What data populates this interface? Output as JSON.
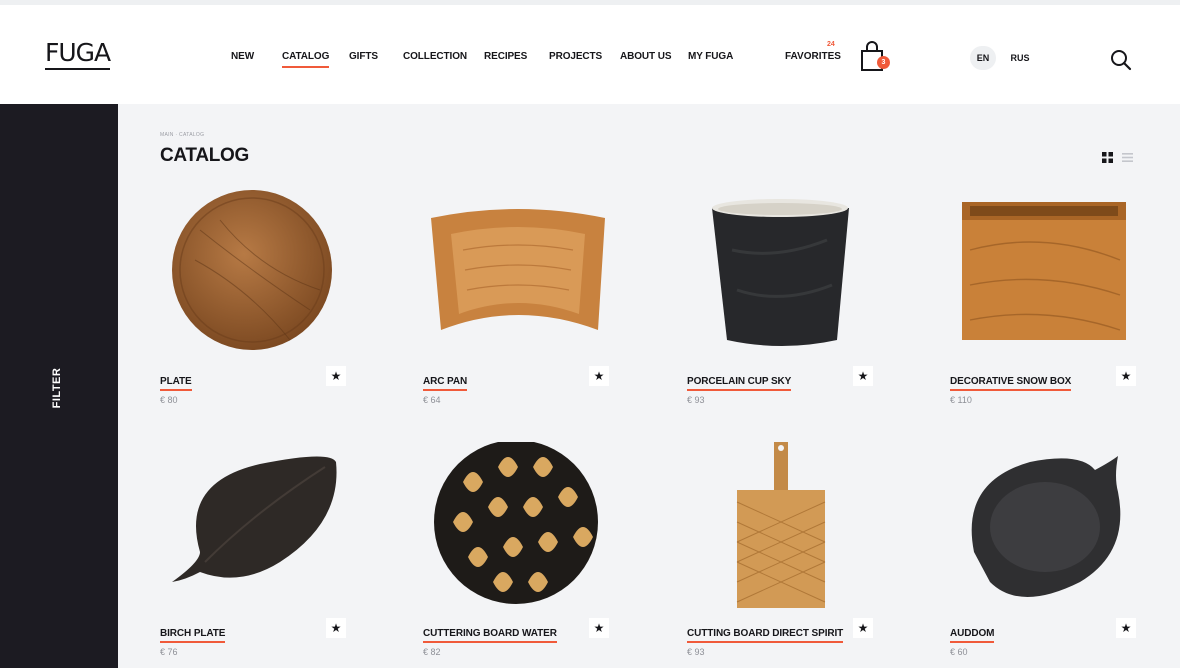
{
  "brand": {
    "logo_text": "FUGA"
  },
  "nav": [
    {
      "label": "NEW"
    },
    {
      "label": "CATALOG",
      "active": true
    },
    {
      "label": "GIFTS"
    },
    {
      "label": "COLLECTION"
    },
    {
      "label": "RECIPES"
    },
    {
      "label": "PROJECTS"
    },
    {
      "label": "ABOUT US"
    },
    {
      "label": "MY FUGA"
    }
  ],
  "header": {
    "favorites_label": "FAVORITES",
    "favorites_count": "24",
    "cart_count": "3",
    "lang_en": "EN",
    "lang_ru": "RUS"
  },
  "sidebar": {
    "filter_label": "FILTER"
  },
  "page": {
    "breadcrumb": "MAIN · CATALOG",
    "title": "CATALOG"
  },
  "products": [
    {
      "name": "PLATE",
      "price": "€ 80"
    },
    {
      "name": "ARC PAN",
      "price": "€ 64"
    },
    {
      "name": "PORCELAIN CUP SKY",
      "price": "€ 93"
    },
    {
      "name": "DECORATIVE SNOW BOX",
      "price": "€ 110"
    },
    {
      "name": "BIRCH PLATE",
      "price": "€ 76"
    },
    {
      "name": "CUTTERING BOARD WATER",
      "price": "€ 82"
    },
    {
      "name": "CUTTING BOARD DIRECT SPIRIT",
      "price": "€ 93"
    },
    {
      "name": "AUDDOM",
      "price": "€ 60"
    }
  ],
  "colors": {
    "accent": "#f05a3a",
    "sidebar": "#1c1b22",
    "background": "#f3f4f6"
  },
  "icons": {
    "favorite": "star-icon",
    "cart": "bag-icon",
    "search": "search-icon"
  }
}
